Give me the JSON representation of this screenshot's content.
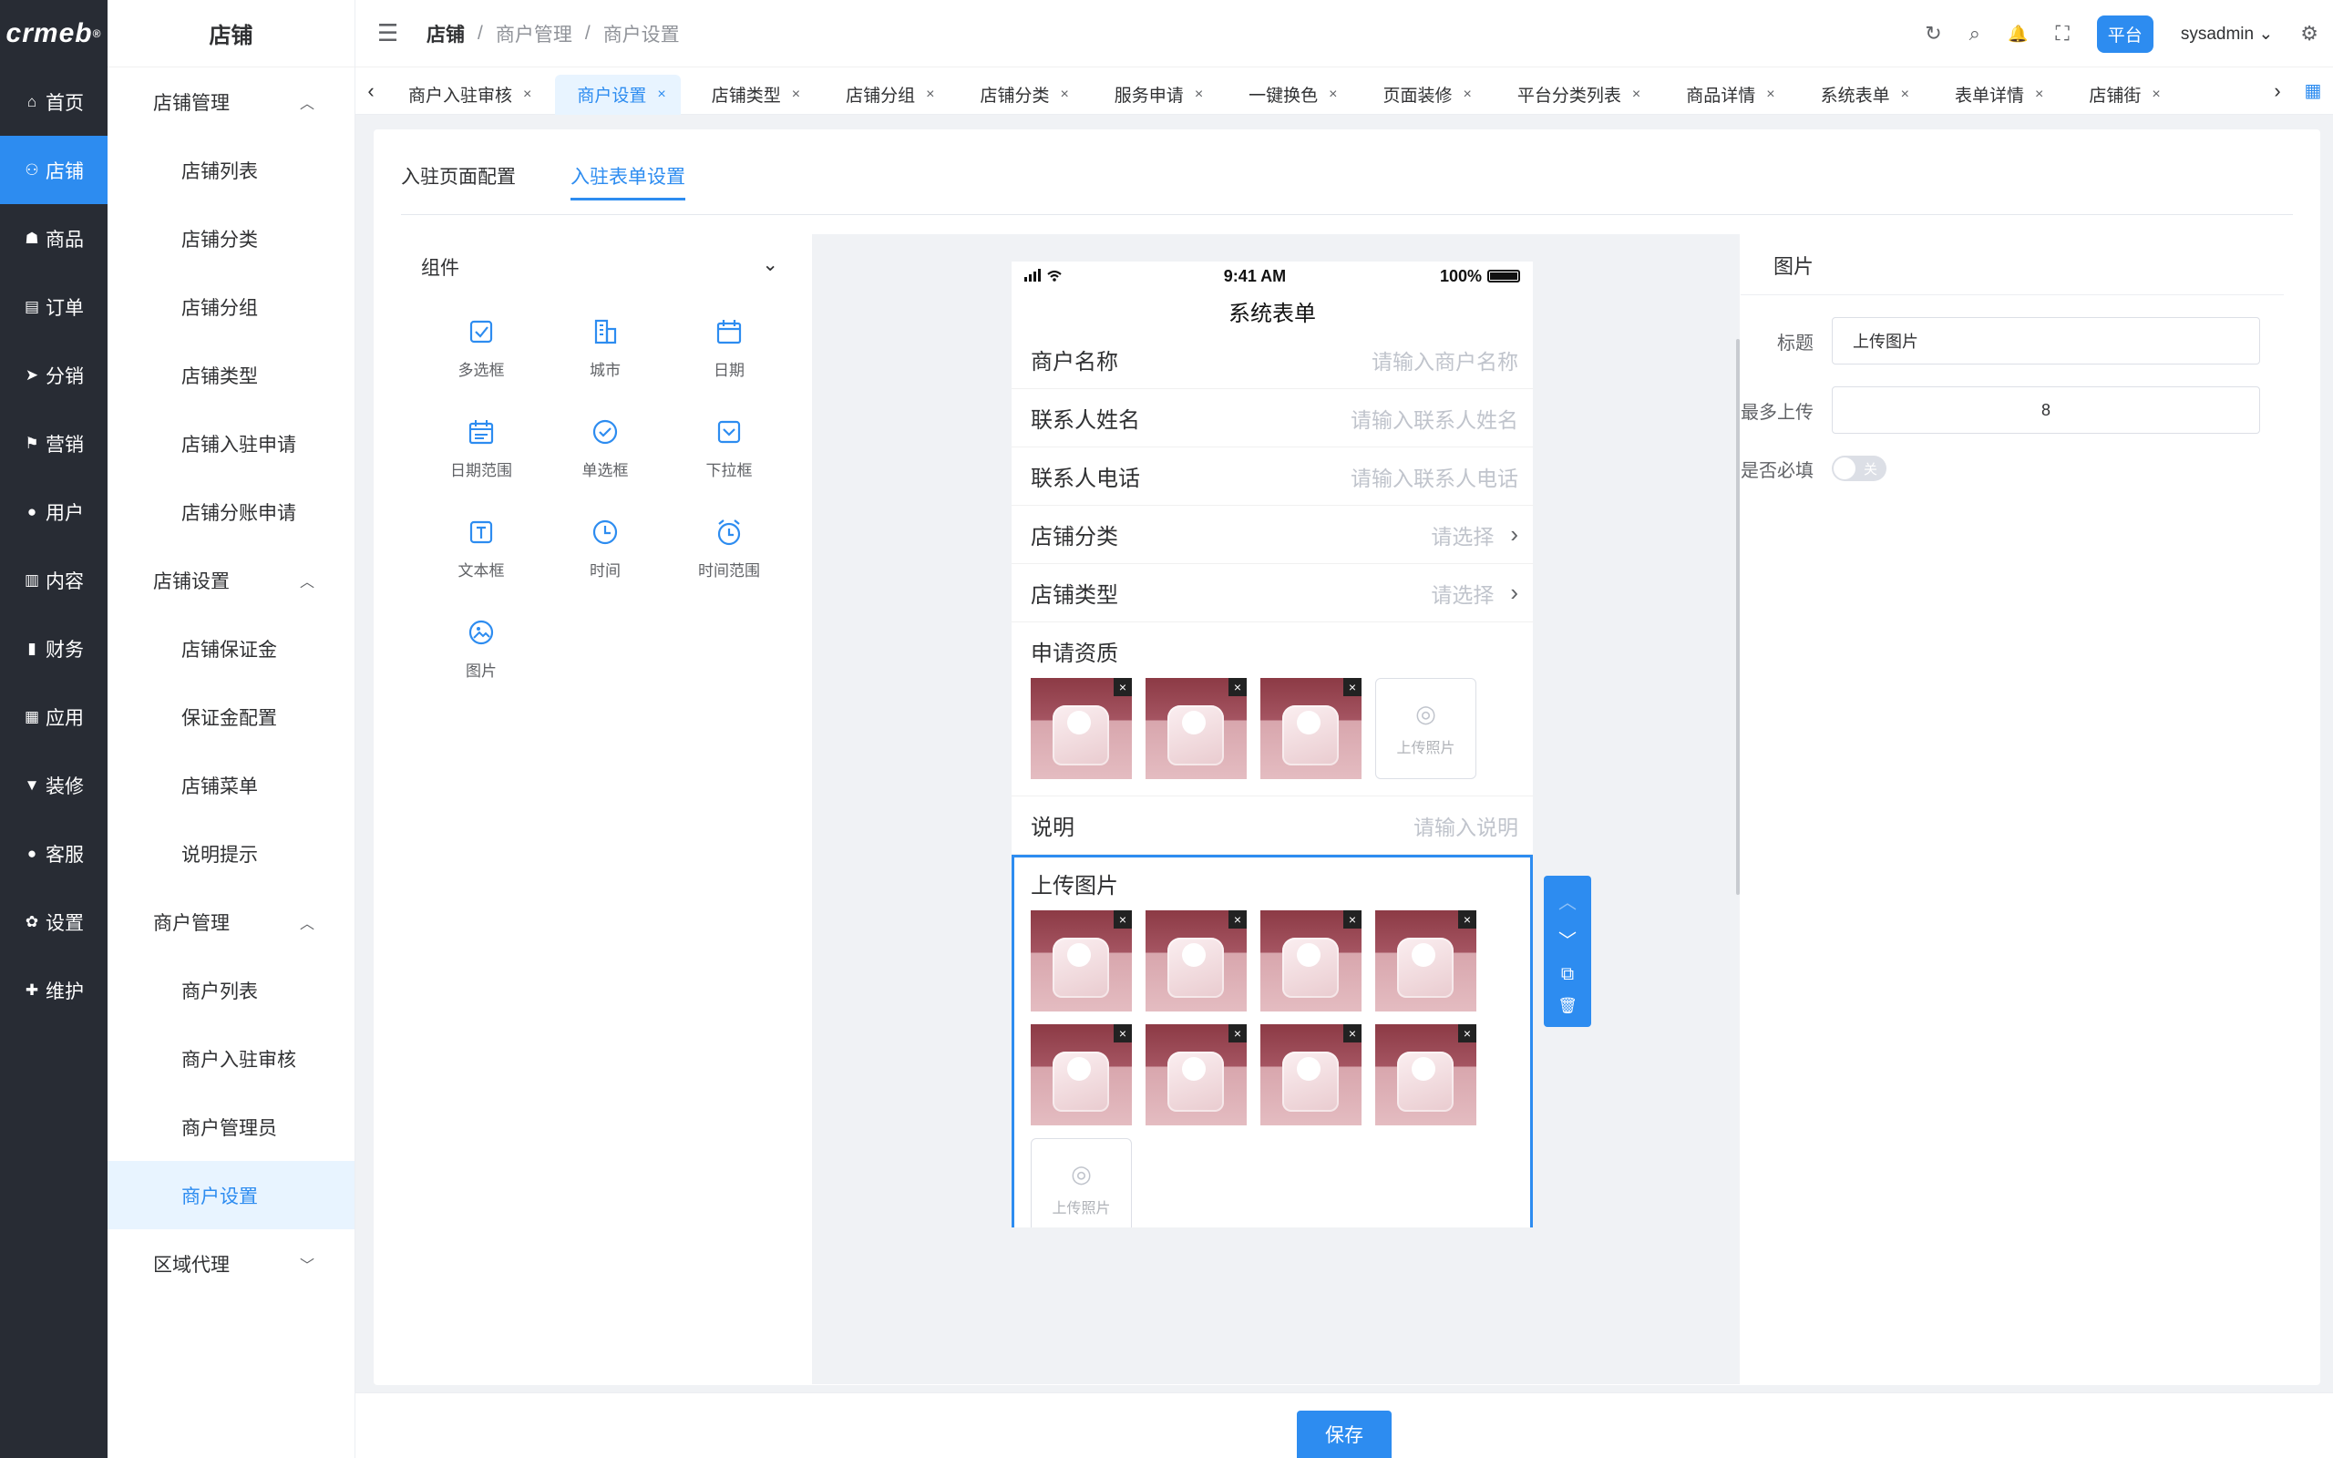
{
  "logo": {
    "text": "crmeb",
    "mark": "®"
  },
  "rail": {
    "items": [
      {
        "label": "首页",
        "icon": "home-icon",
        "glyph": "⌂"
      },
      {
        "label": "店铺",
        "icon": "store-icon",
        "glyph": "⚇"
      },
      {
        "label": "商品",
        "icon": "bag-icon",
        "glyph": "☗"
      },
      {
        "label": "订单",
        "icon": "order-icon",
        "glyph": "▤"
      },
      {
        "label": "分销",
        "icon": "send-icon",
        "glyph": "➤"
      },
      {
        "label": "营销",
        "icon": "flag-icon",
        "glyph": "⚑"
      },
      {
        "label": "用户",
        "icon": "user-icon",
        "glyph": "●"
      },
      {
        "label": "内容",
        "icon": "content-icon",
        "glyph": "▥"
      },
      {
        "label": "财务",
        "icon": "chart-icon",
        "glyph": "▮"
      },
      {
        "label": "应用",
        "icon": "apps-icon",
        "glyph": "▦"
      },
      {
        "label": "装修",
        "icon": "brush-icon",
        "glyph": "▼"
      },
      {
        "label": "客服",
        "icon": "service-icon",
        "glyph": "●"
      },
      {
        "label": "设置",
        "icon": "gear-icon",
        "glyph": "✿"
      },
      {
        "label": "维护",
        "icon": "maintain-icon",
        "glyph": "✚"
      }
    ]
  },
  "submenu": {
    "title": "店铺",
    "g1": "店铺管理",
    "g1_items": [
      "店铺列表",
      "店铺分类",
      "店铺分组",
      "店铺类型",
      "店铺入驻申请",
      "店铺分账申请"
    ],
    "g2": "店铺设置",
    "g2_items": [
      "店铺保证金",
      "保证金配置",
      "店铺菜单",
      "说明提示"
    ],
    "g3": "商户管理",
    "g3_items": [
      "商户列表",
      "商户入驻审核",
      "商户管理员",
      "商户设置"
    ],
    "g4": "区域代理"
  },
  "header": {
    "breadcrumb": [
      "店铺",
      "商户管理",
      "商户设置"
    ],
    "sep": "/",
    "badge": "平台",
    "user": "sysadmin",
    "icons": {
      "refresh": "↻",
      "search": "⌕",
      "bell": "🔔",
      "fullscreen": "⛶",
      "settings": "⚙",
      "menu": "☰",
      "caret": "⌄"
    }
  },
  "tabs": {
    "items": [
      "商户入驻审核",
      "商户设置",
      "店铺类型",
      "店铺分组",
      "店铺分类",
      "服务申请",
      "一键换色",
      "页面装修",
      "平台分类列表",
      "商品详情",
      "系统表单",
      "表单详情",
      "店铺街"
    ],
    "active_index": 1,
    "close": "×",
    "left": "‹",
    "right": "›",
    "grid": "▦"
  },
  "page": {
    "tabs": [
      "入驻页面配置",
      "入驻表单设置"
    ],
    "active_tab": 1
  },
  "components": {
    "title": "组件",
    "chevron": "⌄",
    "items": [
      {
        "label": "多选框",
        "icon": "checkbox-icon"
      },
      {
        "label": "城市",
        "icon": "city-icon"
      },
      {
        "label": "日期",
        "icon": "calendar-icon"
      },
      {
        "label": "日期范围",
        "icon": "date-range-icon"
      },
      {
        "label": "单选框",
        "icon": "radio-icon"
      },
      {
        "label": "下拉框",
        "icon": "dropdown-icon"
      },
      {
        "label": "文本框",
        "icon": "textbox-icon"
      },
      {
        "label": "时间",
        "icon": "clock-icon"
      },
      {
        "label": "时间范围",
        "icon": "alarm-icon"
      },
      {
        "label": "图片",
        "icon": "image-icon"
      }
    ]
  },
  "phone": {
    "time": "9:41 AM",
    "battery": "100%",
    "title": "系统表单",
    "fields": [
      {
        "label": "商户名称",
        "placeholder": "请输入商户名称"
      },
      {
        "label": "联系人姓名",
        "placeholder": "请输入联系人姓名"
      },
      {
        "label": "联系人电话",
        "placeholder": "请输入联系人电话"
      }
    ],
    "selects": [
      {
        "label": "店铺分类",
        "placeholder": "请选择"
      },
      {
        "label": "店铺类型",
        "placeholder": "请选择"
      }
    ],
    "qual_label": "申请资质",
    "qual_count": 3,
    "desc": {
      "label": "说明",
      "placeholder": "请输入说明"
    },
    "upload_label": "上传图片",
    "upload_count": 8,
    "upload_btn": "上传照片",
    "camera": "◎",
    "gt": "›",
    "del": "×"
  },
  "tools": {
    "up": "︿",
    "down": "﹀",
    "copy": "⧉",
    "trash": "🗑"
  },
  "props": {
    "title": "图片",
    "title_label": "标题",
    "title_value": "上传图片",
    "max_label": "最多上传",
    "max_value": "8",
    "required_label": "是否必填",
    "switch_text": "关"
  },
  "footer": {
    "save": "保存"
  }
}
